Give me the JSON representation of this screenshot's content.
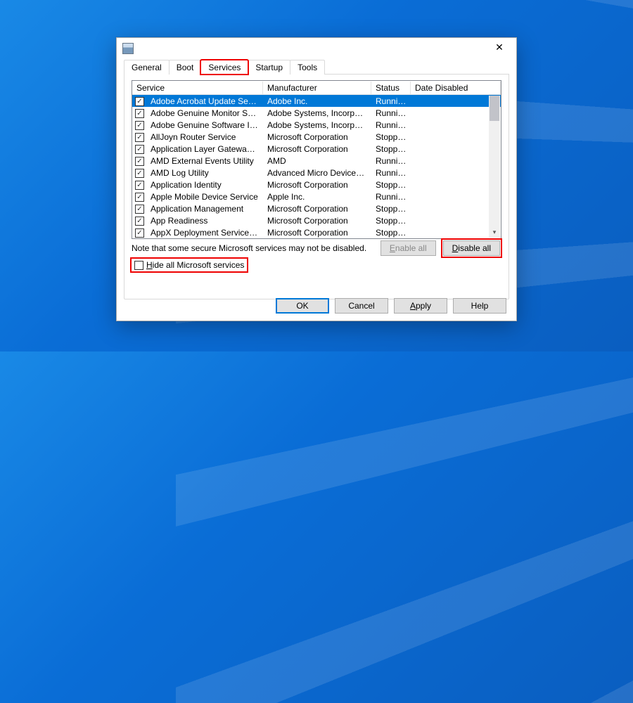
{
  "tabs": {
    "general": "General",
    "boot": "Boot",
    "services": "Services",
    "startup": "Startup",
    "tools": "Tools",
    "active": "services"
  },
  "columns": {
    "service": "Service",
    "manufacturer": "Manufacturer",
    "status": "Status",
    "dateDisabled": "Date Disabled"
  },
  "rows": [
    {
      "checked": true,
      "selected": true,
      "service": "Adobe Acrobat Update Service",
      "manufacturer": "Adobe Inc.",
      "status": "Running"
    },
    {
      "checked": true,
      "service": "Adobe Genuine Monitor Service",
      "manufacturer": "Adobe Systems, Incorpora...",
      "status": "Running"
    },
    {
      "checked": true,
      "service": "Adobe Genuine Software Integri...",
      "manufacturer": "Adobe Systems, Incorpora...",
      "status": "Running"
    },
    {
      "checked": true,
      "service": "AllJoyn Router Service",
      "manufacturer": "Microsoft Corporation",
      "status": "Stopped"
    },
    {
      "checked": true,
      "service": "Application Layer Gateway Service",
      "manufacturer": "Microsoft Corporation",
      "status": "Stopped"
    },
    {
      "checked": true,
      "service": "AMD External Events Utility",
      "manufacturer": "AMD",
      "status": "Running"
    },
    {
      "checked": true,
      "service": "AMD Log Utility",
      "manufacturer": "Advanced Micro Devices, I...",
      "status": "Running"
    },
    {
      "checked": true,
      "service": "Application Identity",
      "manufacturer": "Microsoft Corporation",
      "status": "Stopped"
    },
    {
      "checked": true,
      "service": "Apple Mobile Device Service",
      "manufacturer": "Apple Inc.",
      "status": "Running"
    },
    {
      "checked": true,
      "service": "Application Management",
      "manufacturer": "Microsoft Corporation",
      "status": "Stopped"
    },
    {
      "checked": true,
      "service": "App Readiness",
      "manufacturer": "Microsoft Corporation",
      "status": "Stopped"
    },
    {
      "checked": true,
      "service": "AppX Deployment Service (AppX...",
      "manufacturer": "Microsoft Corporation",
      "status": "Stopped"
    }
  ],
  "note": "Note that some secure Microsoft services may not be disabled.",
  "buttons": {
    "enableAll": "Enable all",
    "disableAll": "Disable all",
    "ok": "OK",
    "cancel": "Cancel",
    "apply": "Apply",
    "help": "Help"
  },
  "hideMs": {
    "label": "Hide all Microsoft services",
    "checked": false
  }
}
